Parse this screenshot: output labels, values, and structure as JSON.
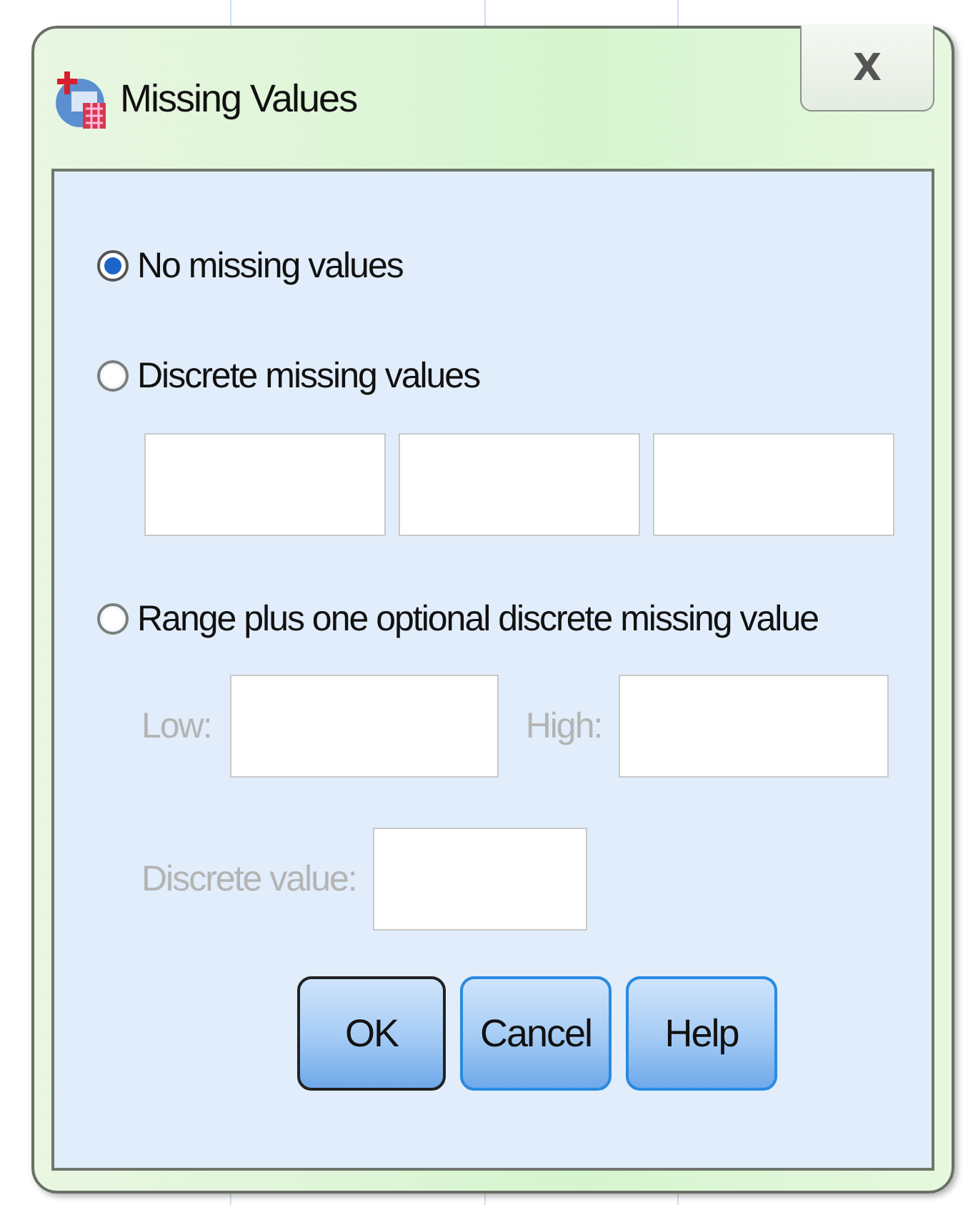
{
  "window": {
    "title": "Missing Values",
    "close": "X"
  },
  "options": [
    {
      "label": "No missing values",
      "selected": true
    },
    {
      "label": "Discrete missing values",
      "selected": false
    },
    {
      "label": "Range plus one optional discrete missing value",
      "selected": false
    }
  ],
  "discrete_fields": [
    {
      "kind": "text"
    },
    {
      "kind": "text"
    },
    {
      "kind": "text"
    }
  ],
  "range": {
    "low_label": "Low:",
    "high_label": "High:",
    "discrete_label": "Discrete value:",
    "disabled": true
  },
  "buttons": [
    {
      "label": "OK",
      "default": true
    },
    {
      "label": "Cancel",
      "default": false
    },
    {
      "label": "Help",
      "default": false
    }
  ]
}
